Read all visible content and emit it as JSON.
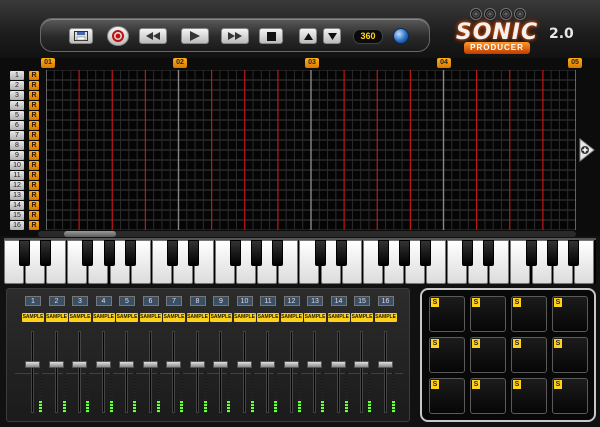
{
  "transport": {
    "buttons": [
      {
        "name": "save-button",
        "icon": "save-icon"
      },
      {
        "name": "record-button",
        "icon": "record-icon"
      },
      {
        "name": "rewind-button",
        "icon": "rewind-icon"
      },
      {
        "name": "play-button",
        "icon": "play-icon"
      },
      {
        "name": "fast-forward-button",
        "icon": "fast-forward-icon"
      },
      {
        "name": "stop-button",
        "icon": "stop-icon"
      },
      {
        "name": "tempo-up-button",
        "icon": "triangle-up-icon"
      },
      {
        "name": "tempo-down-button",
        "icon": "triangle-down-icon"
      }
    ],
    "bpm": "360",
    "globe_icon": "globe-icon"
  },
  "brand": {
    "logo_word": "SONIC",
    "logo_sub": "PRODUCER",
    "version": "2.0"
  },
  "sequencer": {
    "markers": [
      "01",
      "02",
      "03",
      "04",
      "05"
    ],
    "rows": [
      "1",
      "2",
      "3",
      "4",
      "5",
      "6",
      "7",
      "8",
      "9",
      "10",
      "11",
      "12",
      "13",
      "14",
      "15",
      "16"
    ],
    "row_button": "R",
    "steps": 64,
    "expand_icon": "plus-arrow-icon"
  },
  "mixer": {
    "channels": [
      {
        "num": "1",
        "label": "SAMPLE",
        "level": 0.3
      },
      {
        "num": "2",
        "label": "SAMPLE",
        "level": 0.3
      },
      {
        "num": "3",
        "label": "SAMPLE",
        "level": 0.3
      },
      {
        "num": "4",
        "label": "SAMPLE",
        "level": 0.3
      },
      {
        "num": "5",
        "label": "SAMPLE",
        "level": 0.3
      },
      {
        "num": "6",
        "label": "SAMPLE",
        "level": 0.3
      },
      {
        "num": "7",
        "label": "SAMPLE",
        "level": 0.3
      },
      {
        "num": "8",
        "label": "SAMPLE",
        "level": 0.3
      },
      {
        "num": "9",
        "label": "SAMPLE",
        "level": 0.3
      },
      {
        "num": "10",
        "label": "SAMPLE",
        "level": 0.3
      },
      {
        "num": "11",
        "label": "SAMPLE",
        "level": 0.3
      },
      {
        "num": "12",
        "label": "SAMPLE",
        "level": 0.3
      },
      {
        "num": "13",
        "label": "SAMPLE",
        "level": 0.3
      },
      {
        "num": "14",
        "label": "SAMPLE",
        "level": 0.3
      },
      {
        "num": "15",
        "label": "SAMPLE",
        "level": 0.3
      },
      {
        "num": "16",
        "label": "SAMPLE",
        "level": 0.3
      }
    ]
  },
  "pads": {
    "label": "S",
    "count": 12
  },
  "colors": {
    "accent_orange": "#ffb11a",
    "sample_yellow": "#ffd21a",
    "beat_red": "#c01818",
    "meter_green": "#6cff40"
  }
}
